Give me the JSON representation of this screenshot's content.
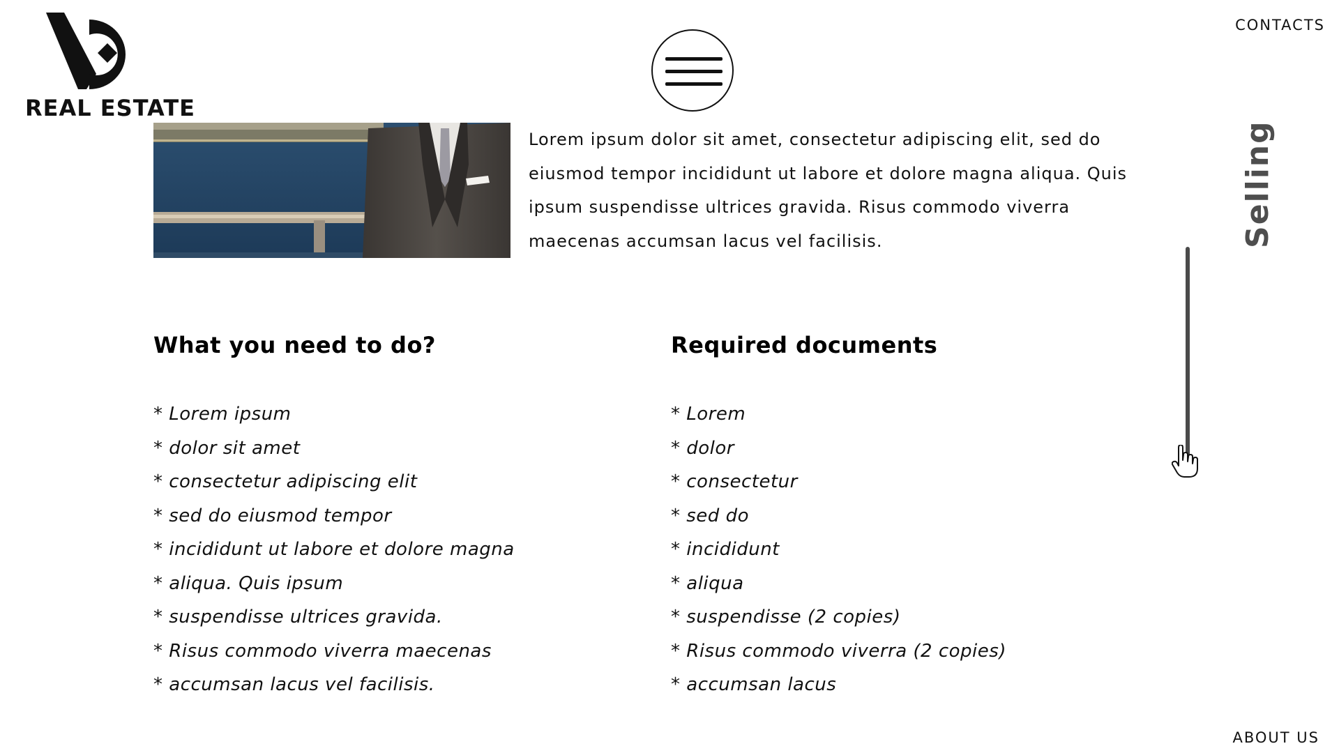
{
  "brand": {
    "name": "REAL ESTATE"
  },
  "nav": {
    "contacts": "CONTACTS",
    "about": "ABOUT US",
    "menu_icon": "hamburger-icon"
  },
  "page": {
    "section_label": "Selling"
  },
  "intro": {
    "text": "Lorem ipsum dolor sit amet, consectetur adipiscing elit, sed do eiusmod tempor incididunt ut labore et dolore magna aliqua. Quis ipsum suspendisse ultrices gravida. Risus commodo viverra maecenas accumsan lacus vel facilisis."
  },
  "what_to_do": {
    "title": "What you need to do?",
    "items": [
      "* Lorem ipsum",
      "* dolor sit amet",
      "* consectetur adipiscing elit",
      "* sed do eiusmod tempor",
      "* incididunt ut labore et dolore magna",
      "* aliqua. Quis ipsum",
      "* suspendisse ultrices gravida.",
      "* Risus commodo viverra maecenas",
      "* accumsan lacus vel facilisis."
    ]
  },
  "documents": {
    "title": "Required documents",
    "items": [
      "* Lorem",
      "* dolor",
      "* consectetur",
      "* sed do",
      "* incididunt",
      "* aliqua",
      "* suspendisse (2 copies)",
      "* Risus commodo viverra (2 copies)",
      "* accumsan lacus"
    ]
  },
  "colors": {
    "text": "#111111",
    "label_gray": "#4e4e4e",
    "scroll": "#4a4a4a",
    "background": "#ffffff"
  }
}
